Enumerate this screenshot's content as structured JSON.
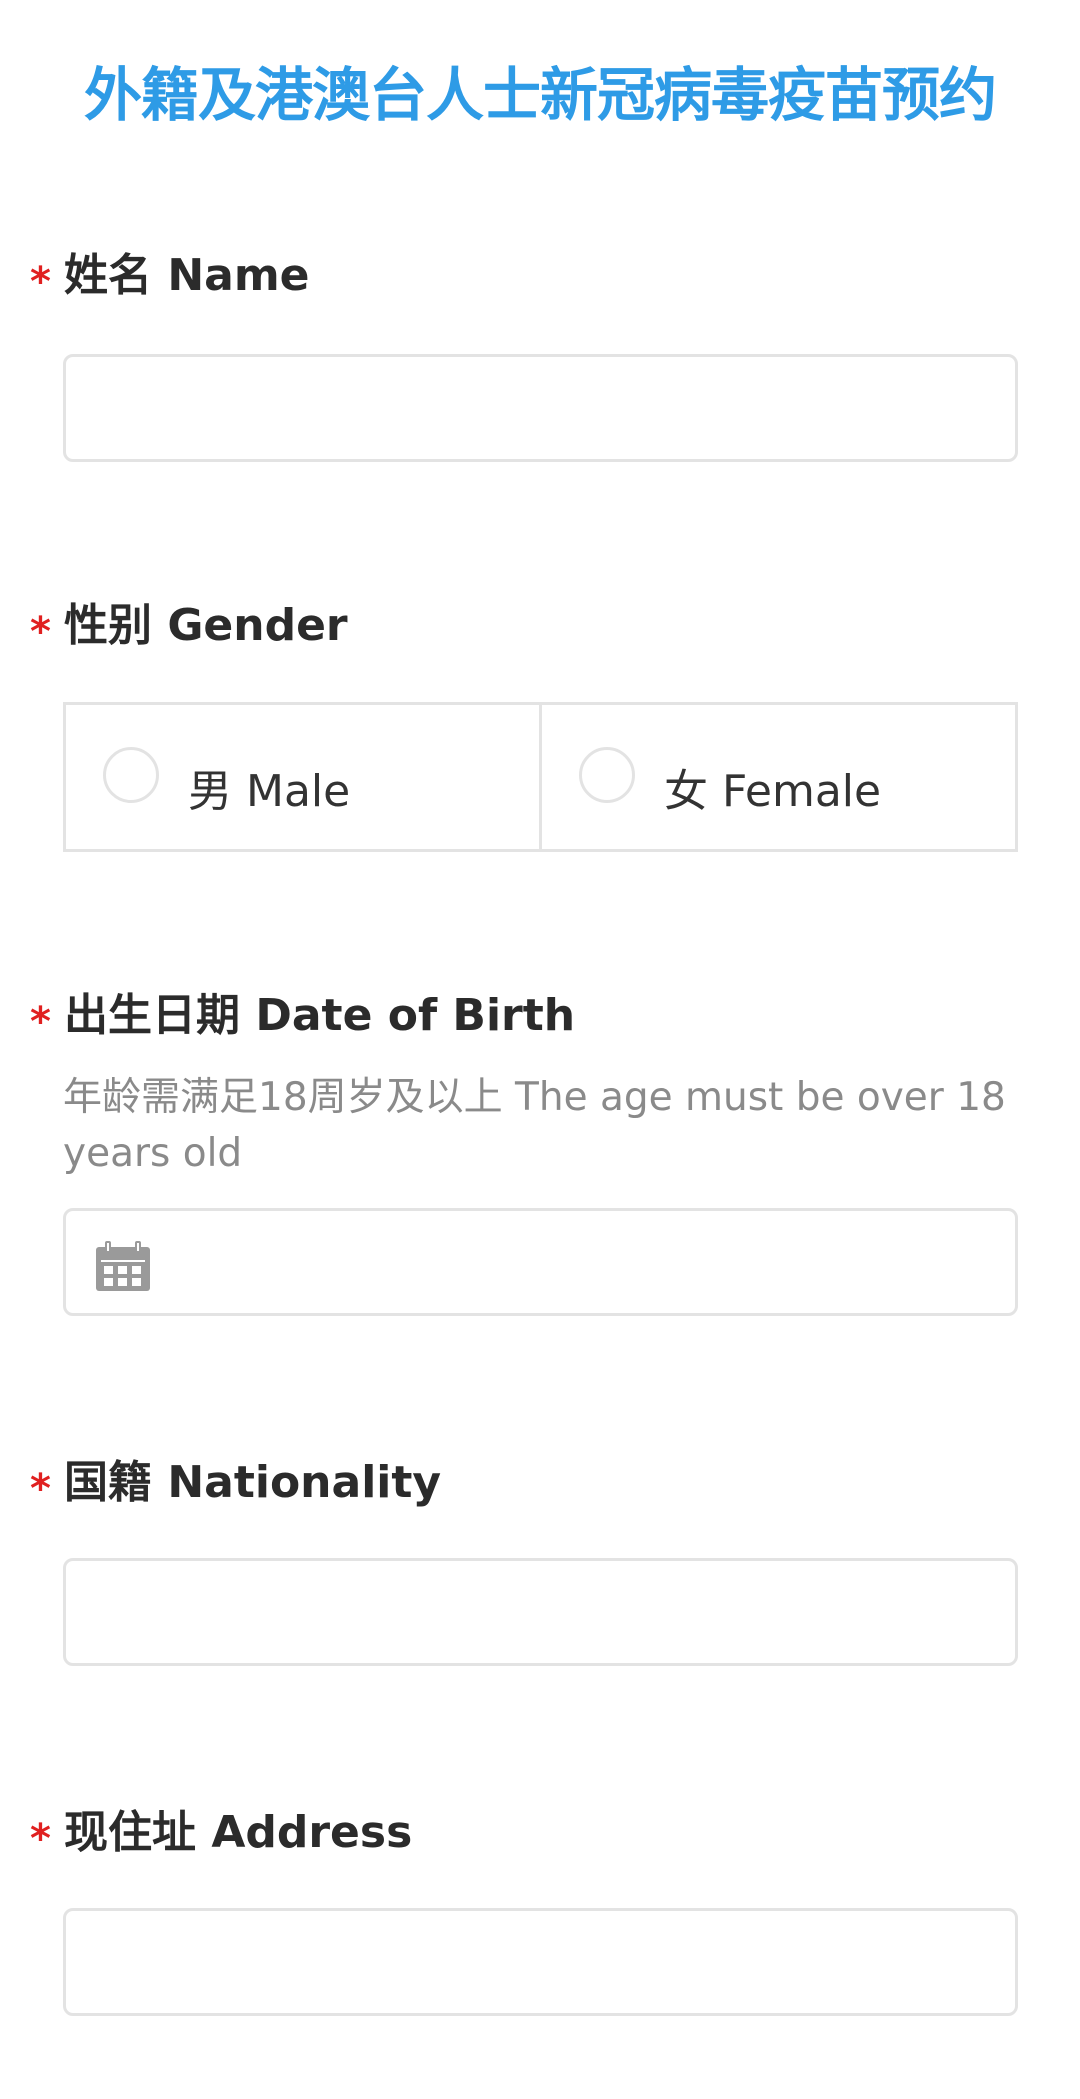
{
  "title": "外籍及港澳台人士新冠病毒疫苗预约",
  "form": {
    "required_mark": "*",
    "name": {
      "label": "姓名 Name",
      "value": ""
    },
    "gender": {
      "label": "性别 Gender",
      "options": [
        {
          "label": "男 Male",
          "selected": false
        },
        {
          "label": "女 Female",
          "selected": false
        }
      ]
    },
    "dob": {
      "label": "出生日期 Date of Birth",
      "hint": "年龄需满足18周岁及以上 The age must be over 18 years old",
      "icon": "calendar-icon",
      "value": ""
    },
    "nationality": {
      "label": "国籍 Nationality",
      "value": ""
    },
    "address": {
      "label": "现住址 Address",
      "value": ""
    }
  },
  "colors": {
    "title": "#2e9be6",
    "required": "#e02020",
    "border": "#e3e3e3",
    "hint": "#8a8a8a",
    "icon": "#9a9a9a"
  }
}
